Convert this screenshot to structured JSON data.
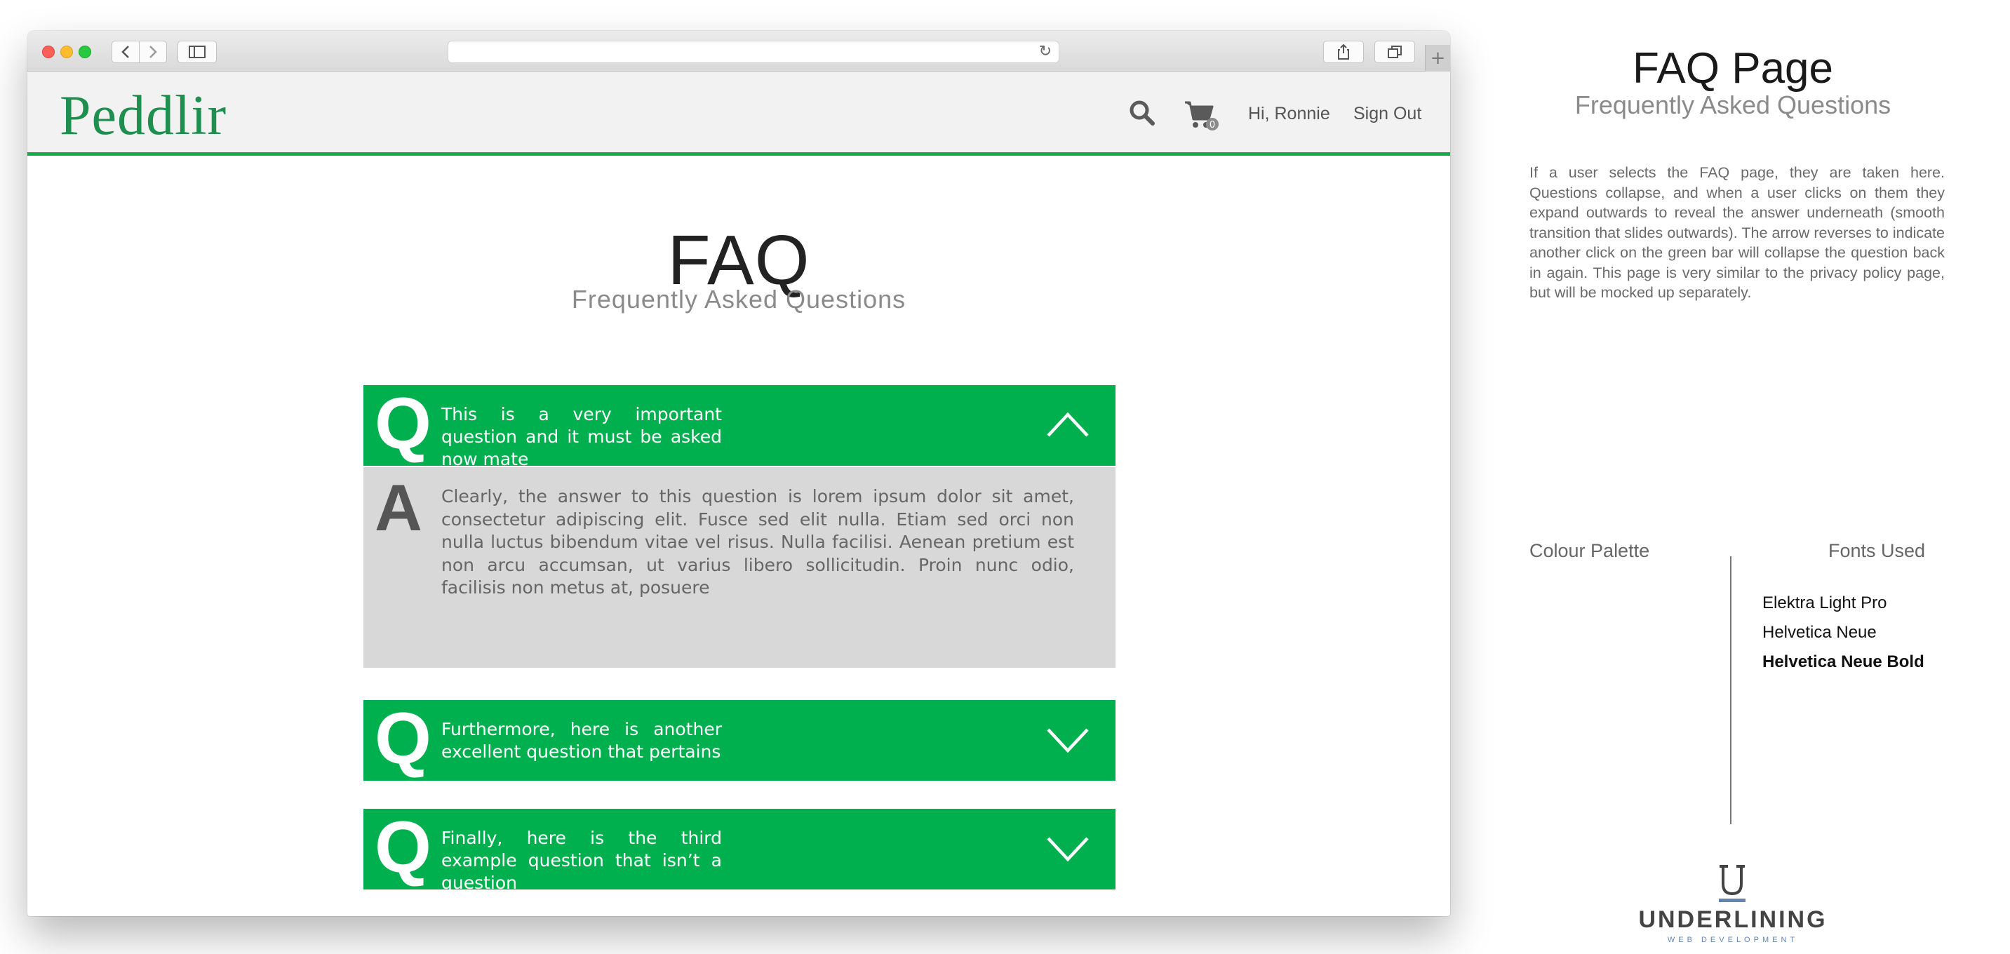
{
  "colors": {
    "accent_green": "#00b04f",
    "logo_green": "#1e8f4e",
    "answer_bg": "#d8d8d8",
    "header_bg": "#f2f2f2",
    "brand_tag_blue": "#5f85b5"
  },
  "browser": {
    "back_icon": "chevron-left-icon",
    "forward_icon": "chevron-right-icon",
    "sidebar_icon": "sidebar-icon",
    "reload_icon": "reload-icon",
    "share_icon": "share-icon",
    "tabs_icon": "tabs-icon",
    "new_tab_icon": "plus-icon"
  },
  "site": {
    "logo": "Peddlir",
    "search_icon": "search-icon",
    "cart_icon": "cart-icon",
    "cart_count": "0",
    "greeting": "Hi, Ronnie",
    "sign_out": "Sign Out"
  },
  "page": {
    "title": "FAQ",
    "subtitle": "Frequently Asked Questions"
  },
  "faq": {
    "q_letter": "Q",
    "a_letter": "A",
    "items": [
      {
        "question": "This is a very important question and it must be asked now mate",
        "expanded": true,
        "answer": "Clearly, the answer to this question is lorem ipsum dolor sit amet, consectetur adipiscing elit. Fusce sed elit nulla. Etiam sed orci non nulla luctus bibendum vitae vel risus. Nulla facilisi. Aenean pretium est non arcu accumsan, ut varius libero sollicitudin. Proin nunc odio, facilisis non metus at, posuere"
      },
      {
        "question": "Furthermore, here is another excellent question that pertains",
        "expanded": false
      },
      {
        "question": "Finally, here is the third example question that isn’t a question",
        "expanded": false
      }
    ]
  },
  "notes": {
    "title": "FAQ Page",
    "subtitle": "Frequently Asked Questions",
    "description": "If a user selects the FAQ page, they are taken here. Questions collapse, and when a user clicks on them they expand outwards to reveal the answer underneath (smooth transition that slides outwards). The arrow reverses to indicate another click on the green bar will collapse the question back in again.  This page is very similar to the privacy policy page, but will be mocked up separately.",
    "palette_label": "Colour Palette",
    "fonts_label": "Fonts Used",
    "fonts": [
      "Elektra Light Pro",
      "Helvetica Neue",
      "Helvetica Neue Bold"
    ],
    "brand_name": "UNDERLINING",
    "brand_tagline": "WEB DEVELOPMENT"
  }
}
